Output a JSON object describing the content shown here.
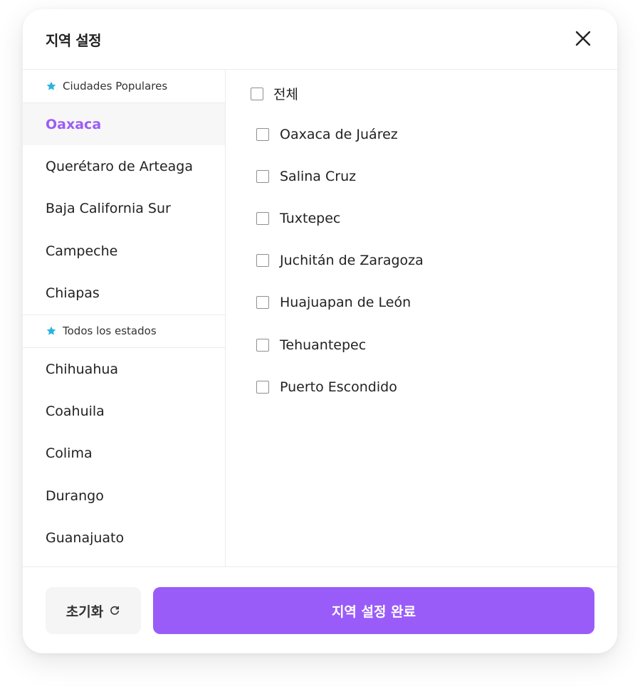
{
  "dialog": {
    "title": "지역 설정",
    "close_icon": "close-icon"
  },
  "colors": {
    "accent": "#9a5cf9",
    "active_text": "#9b5cf6",
    "star": "#2bb3e0"
  },
  "sidebar": {
    "popular_header": "Ciudades Populares",
    "popular_items": [
      {
        "label": "Oaxaca",
        "active": true
      },
      {
        "label": "Querétaro de Arteaga",
        "active": false
      },
      {
        "label": "Baja California Sur",
        "active": false
      },
      {
        "label": "Campeche",
        "active": false
      },
      {
        "label": "Chiapas",
        "active": false
      }
    ],
    "all_header": "Todos los estados",
    "all_items": [
      {
        "label": "Chihuahua"
      },
      {
        "label": "Coahuila"
      },
      {
        "label": "Colima"
      },
      {
        "label": "Durango"
      },
      {
        "label": "Guanajuato"
      }
    ]
  },
  "cities": {
    "select_all": {
      "label": "전체",
      "checked": false
    },
    "items": [
      {
        "label": "Oaxaca de Juárez",
        "checked": false
      },
      {
        "label": "Salina Cruz",
        "checked": false
      },
      {
        "label": "Tuxtepec",
        "checked": false
      },
      {
        "label": "Juchitán de Zaragoza",
        "checked": false
      },
      {
        "label": "Huajuapan de León",
        "checked": false
      },
      {
        "label": "Tehuantepec",
        "checked": false
      },
      {
        "label": "Puerto Escondido",
        "checked": false
      }
    ]
  },
  "footer": {
    "reset_label": "초기화",
    "confirm_label": "지역 설정 완료"
  }
}
